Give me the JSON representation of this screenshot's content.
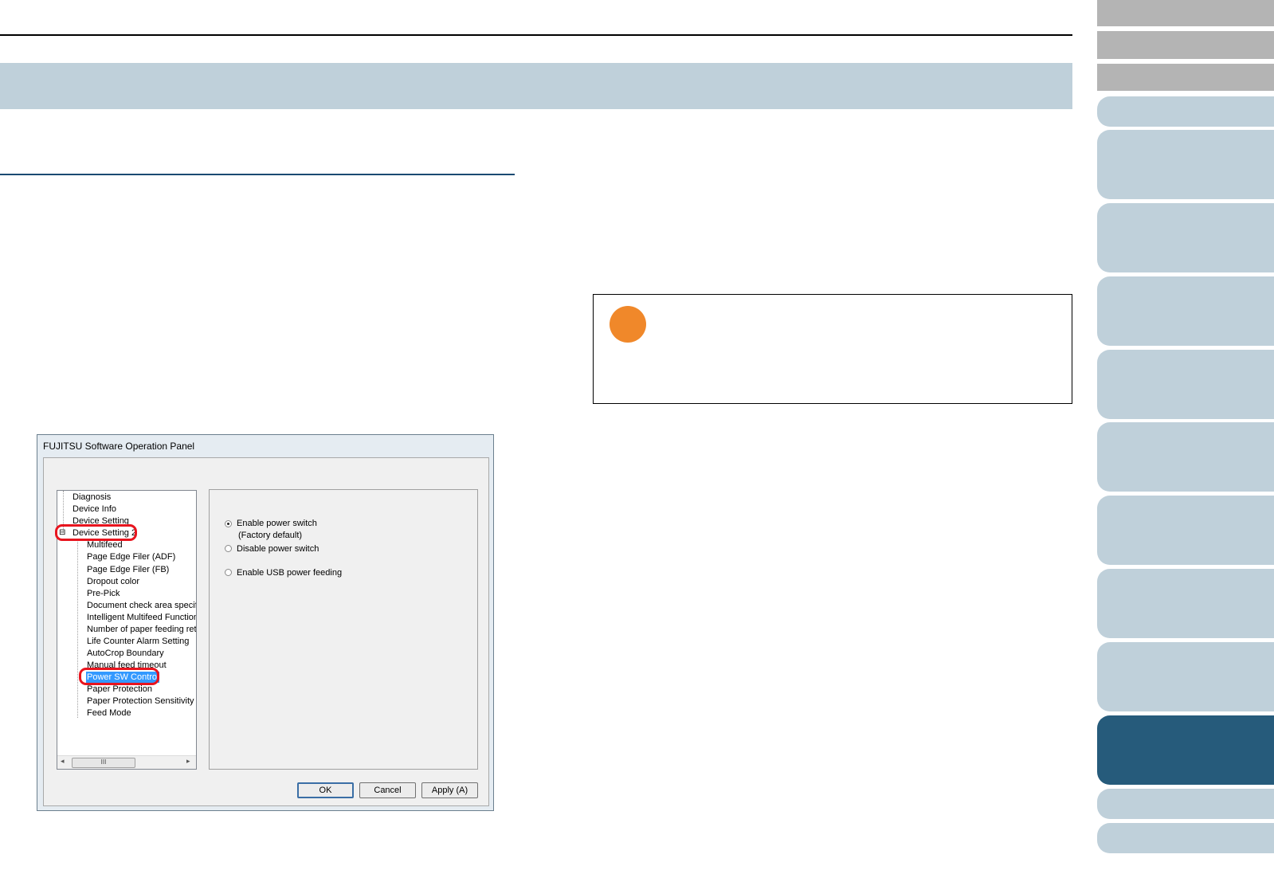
{
  "dialog": {
    "title": "FUJITSU Software Operation Panel",
    "tree": {
      "items": [
        {
          "label": "Diagnosis"
        },
        {
          "label": "Device Info"
        },
        {
          "label": "Device Setting"
        },
        {
          "label": "Device Setting 2",
          "expanded": true,
          "highlighted": true
        }
      ],
      "children": [
        {
          "label": "Multifeed"
        },
        {
          "label": "Page Edge Filer (ADF)"
        },
        {
          "label": "Page Edge Filer (FB)"
        },
        {
          "label": "Dropout color"
        },
        {
          "label": "Pre-Pick"
        },
        {
          "label": "Document check area specific"
        },
        {
          "label": "Intelligent Multifeed Function"
        },
        {
          "label": "Number of paper feeding retries"
        },
        {
          "label": "Life Counter Alarm Setting"
        },
        {
          "label": "AutoCrop Boundary"
        },
        {
          "label": "Manual feed timeout"
        },
        {
          "label": "Power SW Control",
          "selected": true,
          "highlighted": true
        },
        {
          "label": "Paper Protection"
        },
        {
          "label": "Paper Protection Sensitivity"
        },
        {
          "label": "Feed Mode"
        }
      ],
      "scroll_thumb_glyph": "III",
      "expand_glyph": "⊟"
    },
    "options": {
      "enable_power_switch": "Enable power switch",
      "factory_default": "(Factory default)",
      "disable_power_switch": "Disable power switch",
      "enable_usb_power_feeding": "Enable USB power feeding",
      "selected": "enable_power_switch"
    },
    "buttons": {
      "ok": "OK",
      "cancel": "Cancel",
      "apply": "Apply (A)"
    }
  },
  "colors": {
    "title_band": "#bfd0da",
    "nav_active": "#265b7b",
    "note_dot": "#f0882a",
    "highlight": "#e8141e"
  }
}
